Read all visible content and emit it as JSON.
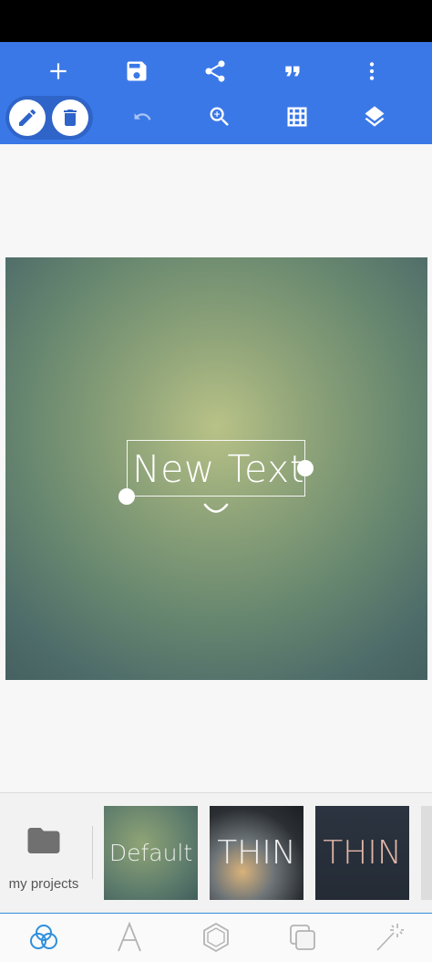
{
  "toolbar": {
    "icons": [
      "add-icon",
      "save-icon",
      "share-icon",
      "quote-icon",
      "more-vert-icon",
      "undo-icon",
      "zoom-icon",
      "grid-icon",
      "layers-icon"
    ],
    "mode_buttons": [
      "edit-icon",
      "delete-icon"
    ],
    "accent": "#3b78e7"
  },
  "canvas": {
    "text_layer": "New Text"
  },
  "templates": {
    "my_projects_label": "my projects",
    "items": [
      {
        "label": "Default"
      },
      {
        "label": "THIN"
      },
      {
        "label": "THIN"
      }
    ]
  },
  "bottom_nav": {
    "icons": [
      "background-icon",
      "text-icon",
      "shape-icon",
      "layer-copy-icon",
      "magic-wand-icon"
    ],
    "active": "background-icon"
  }
}
